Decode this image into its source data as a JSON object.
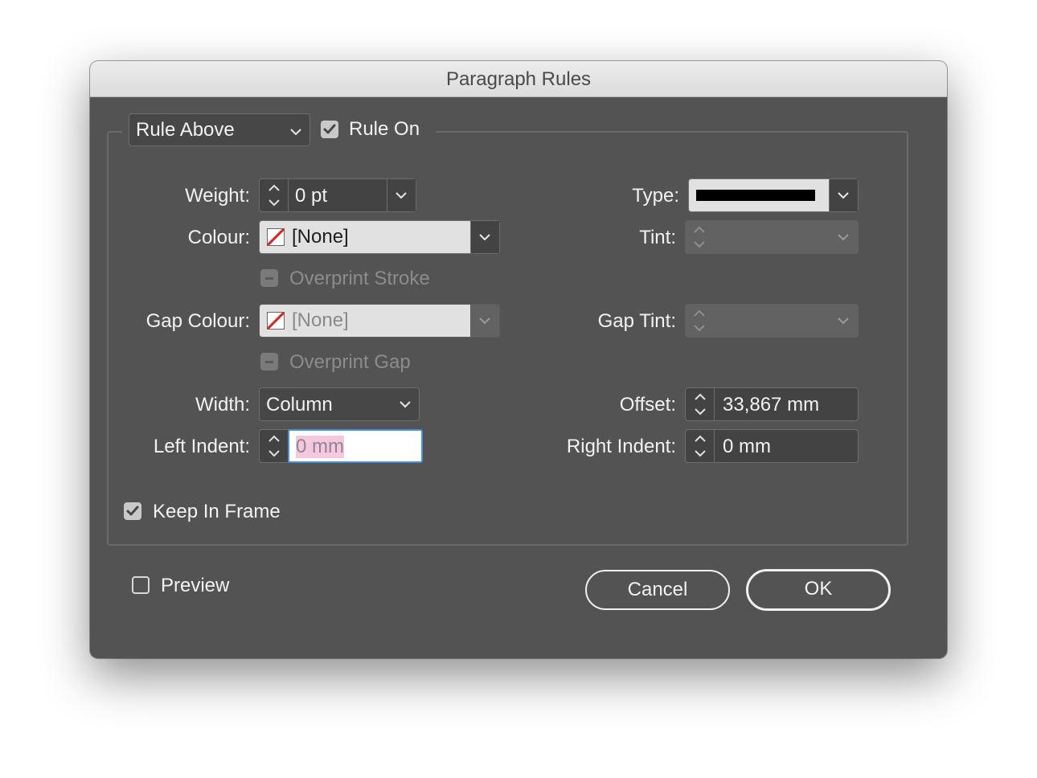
{
  "dialog": {
    "title": "Paragraph Rules"
  },
  "rule_select": {
    "value": "Rule Above"
  },
  "rule_on": {
    "label": "Rule On",
    "checked": true
  },
  "weight": {
    "label": "Weight:",
    "value": "0 pt"
  },
  "colour": {
    "label": "Colour:",
    "value": "[None]"
  },
  "overprint_stroke": {
    "label": "Overprint Stroke",
    "enabled": false
  },
  "gap_colour": {
    "label": "Gap Colour:",
    "value": "[None]",
    "enabled": false
  },
  "overprint_gap": {
    "label": "Overprint Gap",
    "enabled": false
  },
  "width": {
    "label": "Width:",
    "value": "Column"
  },
  "left_indent": {
    "label": "Left Indent:",
    "value": "0 mm"
  },
  "type": {
    "label": "Type:",
    "swatch_color": "#000000"
  },
  "tint": {
    "label": "Tint:",
    "value": "",
    "enabled": false
  },
  "gap_tint": {
    "label": "Gap Tint:",
    "value": "",
    "enabled": false
  },
  "offset": {
    "label": "Offset:",
    "value": "33,867 mm"
  },
  "right_indent": {
    "label": "Right Indent:",
    "value": "0 mm"
  },
  "keep_in_frame": {
    "label": "Keep In Frame",
    "checked": true
  },
  "preview": {
    "label": "Preview",
    "checked": false
  },
  "buttons": {
    "cancel": "Cancel",
    "ok": "OK"
  },
  "colors": {
    "dialog_bg": "#535353",
    "focus_ring": "#4a90e2",
    "selection": "#f6c8e0"
  }
}
